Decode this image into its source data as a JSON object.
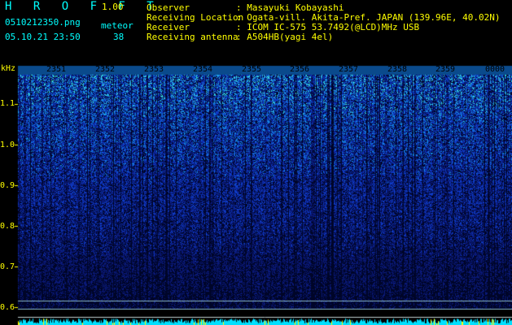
{
  "header": {
    "app_title": "H R O F F T",
    "version": "1.00",
    "filename": "0510212350.png",
    "datetime": "05.10.21 23:50",
    "meteor_label": "meteor",
    "meteor_count": "38"
  },
  "info": [
    {
      "label": "Observer",
      "value": ": Masayuki Kobayashi"
    },
    {
      "label": "Receiving Location",
      "value": ": Ogata-vill. Akita-Pref. JAPAN (139.96E, 40.02N)"
    },
    {
      "label": "Receiver",
      "value": ": ICOM IC-575 53.7492(@LCD)MHz USB"
    },
    {
      "label": "Receiving antenna",
      "value": ": A504HB(yagi 4el)"
    }
  ],
  "axis": {
    "unit": "kHz",
    "ticks": [
      "1.1",
      "1.0",
      "0.9",
      "0.8",
      "0.7",
      "0.6"
    ],
    "time_labels": [
      "2351",
      "2352",
      "2353",
      "2354",
      "2355",
      "2356",
      "2357",
      "2358",
      "2359",
      "0000"
    ]
  },
  "colors": {
    "accent_cyan": "#00ffff",
    "label_yellow": "#ffff00",
    "background": "#000000",
    "spectrum_blue": "#1030a0"
  }
}
